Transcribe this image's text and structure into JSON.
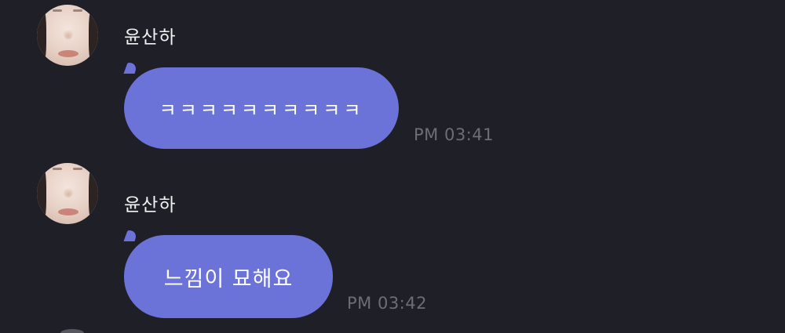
{
  "messages": [
    {
      "sender": "윤산하",
      "text": "ㅋㅋㅋㅋㅋㅋㅋㅋㅋㅋ",
      "time": "PM 03:41"
    },
    {
      "sender": "윤산하",
      "text": "느낌이 묘해요",
      "time": "PM 03:42"
    }
  ],
  "colors": {
    "background": "#1f1f27",
    "bubble": "#6b72d8",
    "timestamp": "#6d6d76",
    "name": "#f2f2f4"
  }
}
